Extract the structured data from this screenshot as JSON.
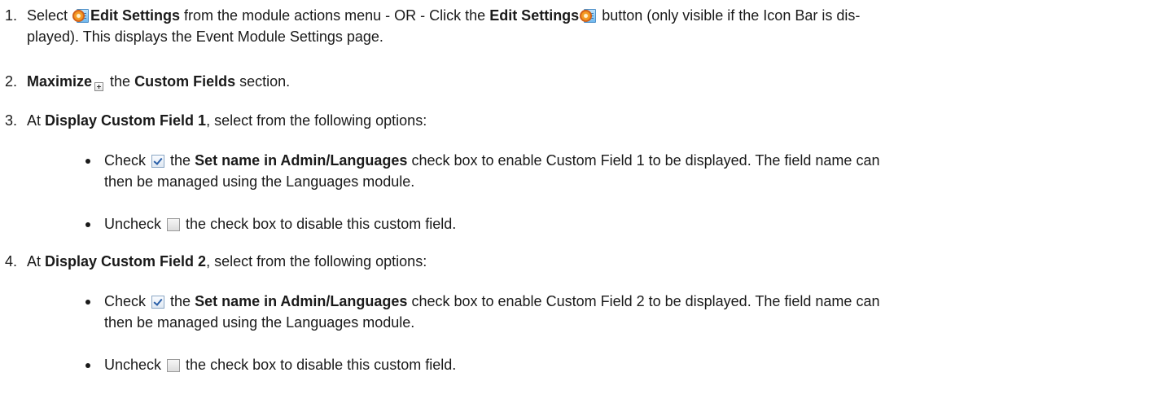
{
  "steps": [
    {
      "number": "1.",
      "segments": {
        "a": "Select ",
        "b": "Edit Settings",
        "c": " from the module actions menu - OR - Click the ",
        "d": "Edit Settings",
        "e": " button (only visible if the Icon Bar is dis-",
        "f": "played). This displays the Event Module Settings page."
      }
    },
    {
      "number": "2.",
      "segments": {
        "a": "Maximize",
        "b": " the ",
        "c": "Custom Fields",
        "d": " section."
      }
    },
    {
      "number": "3.",
      "segments": {
        "a": "At ",
        "b": "Display Custom Field 1",
        "c": ", select from the following options:"
      },
      "bullets": [
        {
          "a": "Check ",
          "b": " the ",
          "c": "Set name in Admin/Languages",
          "d": " check box to enable Custom Field 1 to be displayed. The field name can",
          "e": "then be managed using the Languages module."
        },
        {
          "a": "Uncheck ",
          "b": " the check box to disable this custom field."
        }
      ]
    },
    {
      "number": "4.",
      "segments": {
        "a": "At ",
        "b": "Display Custom Field 2",
        "c": ", select from the following options:"
      },
      "bullets": [
        {
          "a": "Check ",
          "b": " the ",
          "c": "Set name in Admin/Languages",
          "d": " check box to enable Custom Field 2 to be displayed. The field name can",
          "e": "then be managed using the Languages module."
        },
        {
          "a": "Uncheck ",
          "b": " the check box to disable this custom field."
        }
      ]
    }
  ],
  "icons": {
    "settings": "edit-settings-icon",
    "maximize": "maximize-plus-icon",
    "checked": "checked-checkbox-icon",
    "unchecked": "unchecked-checkbox-icon"
  }
}
